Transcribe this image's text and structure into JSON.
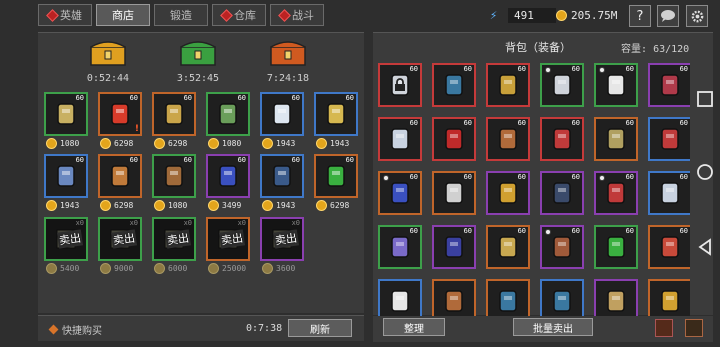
{
  "tabs": [
    {
      "label": "英雄"
    },
    {
      "label": "商店"
    },
    {
      "label": "锻造"
    },
    {
      "label": "仓库"
    },
    {
      "label": "战斗"
    }
  ],
  "resources": {
    "energy": "491",
    "gold": "205.75M"
  },
  "help_label": "?",
  "chests": [
    {
      "timer": "0:52:44",
      "color": "#e0a020"
    },
    {
      "timer": "3:52:45",
      "color": "#3aa040"
    },
    {
      "timer": "7:24:18",
      "color": "#d05a20"
    }
  ],
  "shop_items": [
    {
      "level": "60",
      "price": "1080",
      "border": "#3da04a",
      "color": "#c8b062",
      "alert": false
    },
    {
      "level": "60",
      "price": "6298",
      "border": "#c0652a",
      "color": "#d83b2a",
      "alert": true
    },
    {
      "level": "60",
      "price": "6298",
      "border": "#c0652a",
      "color": "#caa54a",
      "alert": false
    },
    {
      "level": "60",
      "price": "1080",
      "border": "#3da04a",
      "color": "#6a9e5a",
      "alert": false
    },
    {
      "level": "60",
      "price": "1943",
      "border": "#3f78c8",
      "color": "#dde6f0",
      "alert": false
    },
    {
      "level": "60",
      "price": "1943",
      "border": "#3f78c8",
      "color": "#d6b850",
      "alert": false
    },
    {
      "level": "60",
      "price": "1943",
      "border": "#3f78c8",
      "color": "#6a88c0",
      "alert": false
    },
    {
      "level": "60",
      "price": "6298",
      "border": "#c0652a",
      "color": "#c07a3a",
      "alert": false
    },
    {
      "level": "60",
      "price": "1080",
      "border": "#3da04a",
      "color": "#a06a3a",
      "alert": false
    },
    {
      "level": "60",
      "price": "3499",
      "border": "#8a3fb0",
      "color": "#3a50c0",
      "alert": false
    },
    {
      "level": "60",
      "price": "1943",
      "border": "#3f78c8",
      "color": "#3a5a8a",
      "alert": false
    },
    {
      "level": "60",
      "price": "6298",
      "border": "#c0652a",
      "color": "#3ab040",
      "alert": false
    }
  ],
  "sold_items": [
    {
      "count": "x0",
      "price": "5400",
      "border": "#3da04a",
      "sell": "卖出"
    },
    {
      "count": "x0",
      "price": "9000",
      "border": "#3da04a",
      "sell": "卖出"
    },
    {
      "count": "x0",
      "price": "6000",
      "border": "#3da04a",
      "sell": "卖出"
    },
    {
      "count": "x0",
      "price": "25000",
      "border": "#c0652a",
      "sell": "卖出"
    },
    {
      "count": "x0",
      "price": "3600",
      "border": "#8a3fb0",
      "sell": "卖出"
    }
  ],
  "quick_buy": "快捷购买",
  "refresh_timer": "0:7:38",
  "refresh_label": "刷新",
  "bag": {
    "title": "背包（装备）",
    "capacity_label": "容量:",
    "capacity": "63/120"
  },
  "bag_items": [
    {
      "level": "60",
      "border": "#c53a3a",
      "color": "#cfd3da",
      "lock": true
    },
    {
      "level": "60",
      "border": "#c53a3a",
      "color": "#3a78a0"
    },
    {
      "level": "60",
      "border": "#c53a3a",
      "color": "#c8a03a"
    },
    {
      "level": "60",
      "border": "#3da04a",
      "color": "#cfd3da",
      "dot": true
    },
    {
      "level": "60",
      "border": "#3da04a",
      "color": "#e6e6e6",
      "dot": true
    },
    {
      "level": "60",
      "border": "#8a3fb0",
      "color": "#b03a4a"
    },
    {
      "level": "60",
      "border": "#c53a3a",
      "color": "#c8d2e0"
    },
    {
      "level": "60",
      "border": "#c53a3a",
      "color": "#c02a2a"
    },
    {
      "level": "60",
      "border": "#c53a3a",
      "color": "#b06a3a"
    },
    {
      "level": "60",
      "border": "#c53a3a",
      "color": "#c03a3a"
    },
    {
      "level": "60",
      "border": "#c0652a",
      "color": "#b0a060"
    },
    {
      "level": "60",
      "border": "#3f78c8",
      "color": "#c03a3a"
    },
    {
      "level": "60",
      "border": "#c0652a",
      "color": "#3a50c0",
      "dot": true
    },
    {
      "level": "60",
      "border": "#c0652a",
      "color": "#d0d0d0"
    },
    {
      "level": "60",
      "border": "#8a3fb0",
      "color": "#d0a030"
    },
    {
      "level": "60",
      "border": "#8a3fb0",
      "color": "#3a4a6a"
    },
    {
      "level": "60",
      "border": "#8a3fb0",
      "color": "#c03a3a",
      "dot": true
    },
    {
      "level": "60",
      "border": "#3f78c8",
      "color": "#c8d2e0"
    },
    {
      "level": "60",
      "border": "#3da04a",
      "color": "#7a6ac8"
    },
    {
      "level": "60",
      "border": "#8a3fb0",
      "color": "#3a40a0"
    },
    {
      "level": "60",
      "border": "#c0652a",
      "color": "#c8a850"
    },
    {
      "level": "60",
      "border": "#8a3fb0",
      "color": "#a05a3a",
      "dot": true
    },
    {
      "level": "60",
      "border": "#3da04a",
      "color": "#3ab040"
    },
    {
      "level": "60",
      "border": "#c0652a",
      "color": "#c84a3a"
    },
    {
      "level": "",
      "border": "#3f78c8",
      "color": "#e6e6e6"
    },
    {
      "level": "",
      "border": "#c0652a",
      "color": "#b06a3a"
    },
    {
      "level": "",
      "border": "#c0652a",
      "color": "#3a78a0"
    },
    {
      "level": "",
      "border": "#3f78c8",
      "color": "#3a78a0"
    },
    {
      "level": "",
      "border": "#8a3fb0",
      "color": "#c0a060"
    },
    {
      "level": "",
      "border": "#c0652a",
      "color": "#d0a030"
    }
  ],
  "organize_label": "整理",
  "bulk_sell_label": "批量卖出"
}
